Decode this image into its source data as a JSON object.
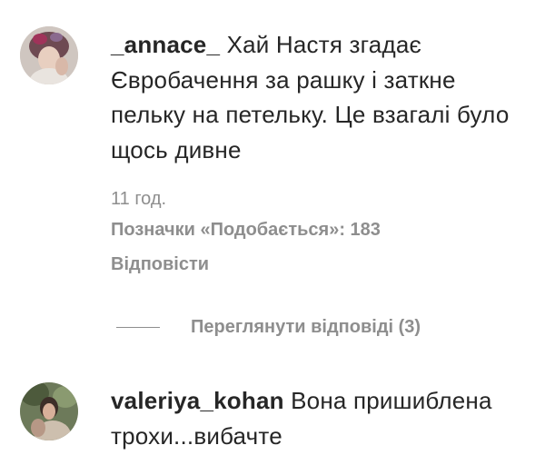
{
  "comments": [
    {
      "username": "_annace_",
      "text": "Хай Настя згадає Євробачення за рашку і заткне пельку на петельку. Це взагалі було щось дивне",
      "time": "11 год.",
      "likes": "Позначки «Подобається»: 183",
      "reply": "Відповісти",
      "view_replies": "Переглянути відповіді (3)"
    },
    {
      "username": "valeriya_kohan",
      "text": "Вона пришиблена трохи...вибачте"
    }
  ],
  "colors": {
    "text_primary": "#262626",
    "text_secondary": "#8e8e8e",
    "background": "#ffffff"
  }
}
